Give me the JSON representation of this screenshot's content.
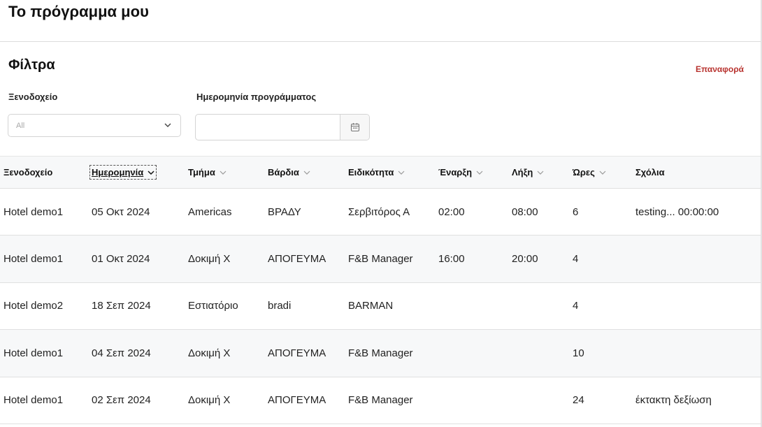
{
  "page": {
    "title": "Το πρόγραμμα μου"
  },
  "filters": {
    "title": "Φίλτρα",
    "reset_label": "Επαναφορά",
    "hotel": {
      "label": "Ξενοδοχείο",
      "value": "All",
      "icon": "chevron-down-icon"
    },
    "schedule_date": {
      "label": "Ημερομηνία προγράμματος",
      "value": "",
      "placeholder": "",
      "icon": "calendar-icon"
    }
  },
  "table": {
    "sorted_column": "Ημερομηνία",
    "columns": [
      {
        "label": "Ξενοδοχείο",
        "sortable": false
      },
      {
        "label": "Ημερομηνία",
        "sortable": true
      },
      {
        "label": "Τμήμα",
        "sortable": true
      },
      {
        "label": "Βάρδια",
        "sortable": true
      },
      {
        "label": "Ειδικότητα",
        "sortable": true
      },
      {
        "label": "Έναρξη",
        "sortable": true
      },
      {
        "label": "Λήξη",
        "sortable": true
      },
      {
        "label": "Ώρες",
        "sortable": true
      },
      {
        "label": "Σχόλια",
        "sortable": false
      }
    ],
    "rows": [
      {
        "hotel": "Hotel demo1",
        "date": "05 Οκτ 2024",
        "department": "Americas",
        "shift": "ΒΡΑΔΥ",
        "specialty": "Σερβιτόρος Α",
        "start": "02:00",
        "end": "08:00",
        "hours": "6",
        "comments": "testing... 00:00:00"
      },
      {
        "hotel": "Hotel demo1",
        "date": "01 Οκτ 2024",
        "department": "Δοκιμή Χ",
        "shift": "ΑΠΟΓΕΥΜΑ",
        "specialty": "F&B Manager",
        "start": "16:00",
        "end": "20:00",
        "hours": "4",
        "comments": ""
      },
      {
        "hotel": "Hotel demo2",
        "date": "18 Σεπ 2024",
        "department": "Εστιατόριο",
        "shift": "bradi",
        "specialty": "BARMAN",
        "start": "",
        "end": "",
        "hours": "4",
        "comments": ""
      },
      {
        "hotel": "Hotel demo1",
        "date": "04 Σεπ 2024",
        "department": "Δοκιμή Χ",
        "shift": "ΑΠΟΓΕΥΜΑ",
        "specialty": "F&B Manager",
        "start": "",
        "end": "",
        "hours": "10",
        "comments": ""
      },
      {
        "hotel": "Hotel demo1",
        "date": "02 Σεπ 2024",
        "department": "Δοκιμή Χ",
        "shift": "ΑΠΟΓΕΥΜΑ",
        "specialty": "F&B Manager",
        "start": "",
        "end": "",
        "hours": "24",
        "comments": "έκτακτη δεξίωση"
      }
    ]
  },
  "colors": {
    "accent": "#b8332f",
    "header_bg": "#f7f8f9",
    "border": "#e0e0e0"
  }
}
